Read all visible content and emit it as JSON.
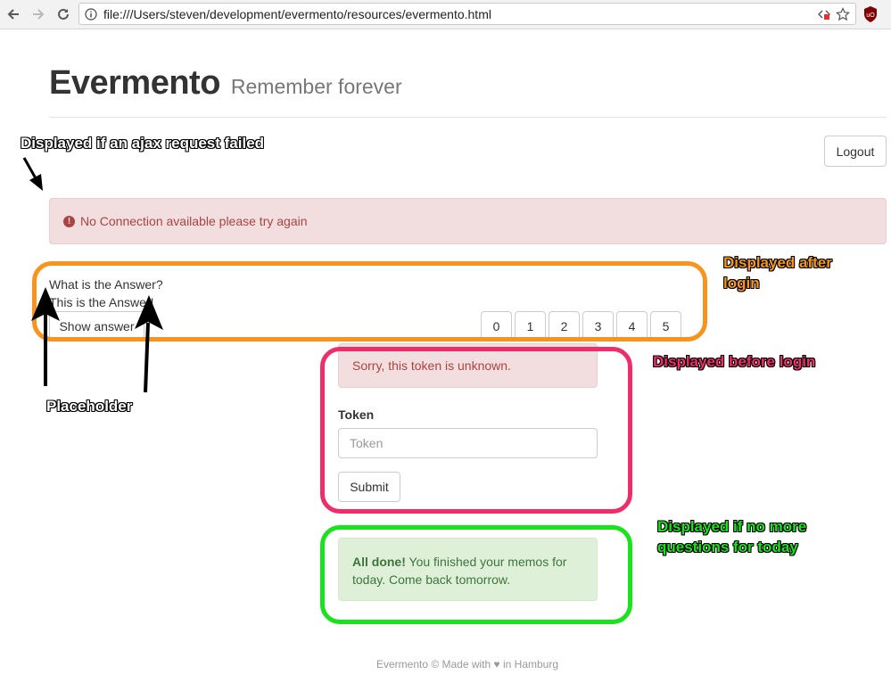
{
  "browser": {
    "url": "file:///Users/steven/development/evermento/resources/evermento.html"
  },
  "header": {
    "title": "Evermento",
    "subtitle": "Remember forever"
  },
  "logout_label": "Logout",
  "connection_alert": "No Connection available please try again",
  "card": {
    "question": "What is the Answer?",
    "answer": "This is the Answer!",
    "show_answer_label": "Show answer",
    "ratings": [
      "0",
      "1",
      "2",
      "3",
      "4",
      "5"
    ]
  },
  "login": {
    "error": "Sorry, this token is unknown.",
    "token_label": "Token",
    "token_placeholder": "Token",
    "submit_label": "Submit"
  },
  "done": {
    "strong": "All done!",
    "text": " You finished your memos for today. Come back tomorrow."
  },
  "footer": "Evermento © Made with ♥ in Hamburg",
  "annotations": {
    "ajax_failed": "Displayed if an ajax request failed",
    "after_login_line1": "Displayed after",
    "after_login_line2": "login",
    "before_login": "Displayed before login",
    "no_more_line1": "Displayed if no more",
    "no_more_line2": "questions for today",
    "placeholder": "Placeholder"
  },
  "colors": {
    "orange": "#f7941d",
    "pink": "#ef2d6b",
    "green": "#19e31c",
    "danger_text": "#a94442",
    "success_text": "#3c763d"
  }
}
